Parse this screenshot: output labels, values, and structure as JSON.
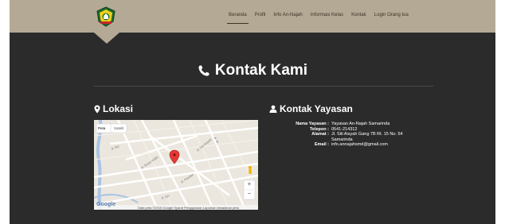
{
  "nav": {
    "links": [
      {
        "label": "Beranda",
        "active": true
      },
      {
        "label": "Profil",
        "active": false
      },
      {
        "label": "Info An-Najah",
        "active": false
      },
      {
        "label": "Informasi Kelas",
        "active": false
      },
      {
        "label": "Kontak",
        "active": false
      },
      {
        "label": "Login Orang tua",
        "active": false
      }
    ]
  },
  "heading": "Kontak Kami",
  "location": {
    "title": "Lokasi",
    "map": {
      "tab_map": "Peta",
      "tab_satellite": "Satelit",
      "google": "Google",
      "footer": "Data peta ©2015 Google   Syarat Penggunaan   Laporkan kesalahan peta",
      "zoom_in": "+",
      "zoom_out": "−"
    }
  },
  "contact": {
    "title": "Kontak Yayasan",
    "rows": [
      {
        "label": "Nama Yayasan :",
        "value": "Yayasan An-Najah Samarinda"
      },
      {
        "label": "Telepon :",
        "value": "0541-214312"
      },
      {
        "label": "Alamat :",
        "value": "Jl. Siti Aisyah Gang 7B Rt. 15 No. 54"
      },
      {
        "label": "",
        "value": "Samarinda"
      },
      {
        "label": "Email :",
        "value": "info.annajahsmd@gmail.com"
      }
    ]
  },
  "colors": {
    "navbar": "#b4a995",
    "background": "#2b2b2b",
    "text": "#ffffff",
    "map_pin": "#e53935"
  }
}
